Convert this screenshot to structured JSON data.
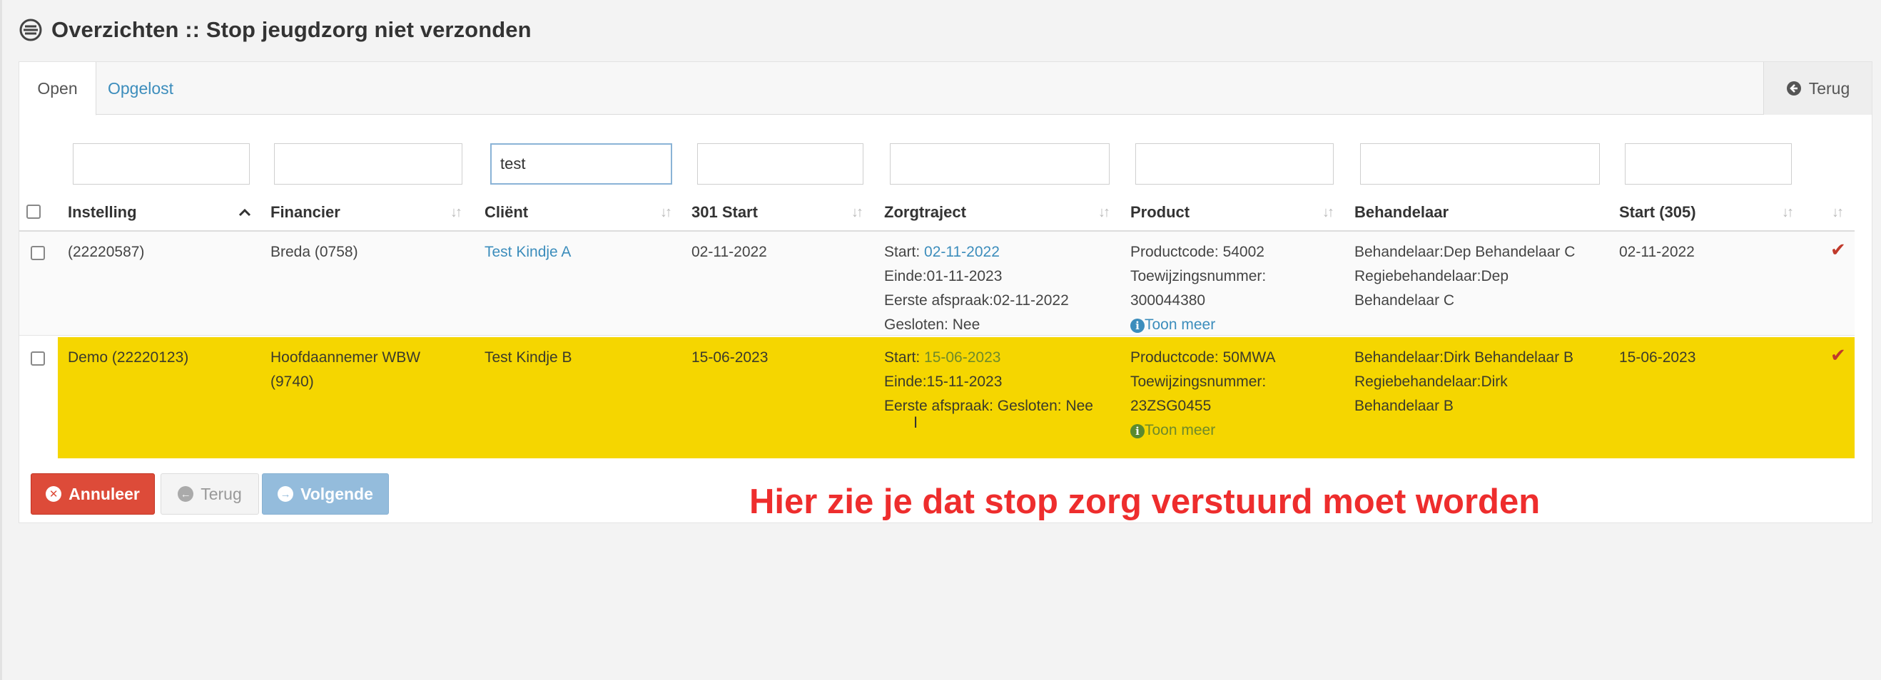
{
  "page": {
    "title": "Overzichten :: Stop jeugdzorg niet verzonden",
    "icon": "list-icon"
  },
  "tabs": [
    {
      "label": "Open",
      "active": true
    },
    {
      "label": "Opgelost",
      "active": false
    }
  ],
  "back_top": {
    "label": "Terug",
    "icon": "arrow-left-circle-icon"
  },
  "filters": {
    "instelling": "",
    "financier": "",
    "client": "test",
    "start301": "",
    "zorgtraject": "",
    "product": "",
    "behandelaar": "",
    "start305": ""
  },
  "columns": {
    "instelling": "Instelling",
    "financier": "Financier",
    "client": "Cliënt",
    "start301": "301 Start",
    "zorgtraject": "Zorgtraject",
    "product": "Product",
    "behandelaar": "Behandelaar",
    "start305": "Start (305)"
  },
  "rows": [
    {
      "highlighted": false,
      "instelling": "(22220587)",
      "financier": [
        "Breda (0758)"
      ],
      "client": "Test Kindje A",
      "start301": "02-11-2022",
      "zorgtraject": {
        "start_label": "Start: ",
        "start_date": "02-11-2022",
        "einde": "Einde:01-11-2023",
        "eerste": "Eerste afspraak:02-11-2022",
        "gesloten": "Gesloten: Nee"
      },
      "product": {
        "productcode": "Productcode: 54002",
        "toewijzing_label": "Toewijzingsnummer:",
        "toewijzing_nummer": "300044380",
        "toon_meer": "Toon meer"
      },
      "behandelaar": [
        "Behandelaar:Dep Behandelaar C",
        "Regiebehandelaar:Dep",
        "Behandelaar C"
      ],
      "start305": "02-11-2022"
    },
    {
      "highlighted": true,
      "instelling": "Demo (22220123)",
      "financier": [
        "Hoofdaannemer WBW",
        "(9740)"
      ],
      "client": "Test Kindje B",
      "start301": "15-06-2023",
      "zorgtraject": {
        "start_label": "Start: ",
        "start_date": "15-06-2023",
        "einde": "Einde:15-11-2023",
        "eerste": "Eerste afspraak: Gesloten: Nee"
      },
      "product": {
        "productcode": "Productcode: 50MWA",
        "toewijzing_label": "Toewijzingsnummer:",
        "toewijzing_nummer": "23ZSG0455",
        "toon_meer": "Toon meer"
      },
      "behandelaar": [
        "Behandelaar:Dirk Behandelaar B",
        "Regiebehandelaar:Dirk",
        "Behandelaar B"
      ],
      "start305": "15-06-2023"
    }
  ],
  "buttons": {
    "annuleer": "Annuleer",
    "terug": "Terug",
    "volgende": "Volgende"
  },
  "annotation": "Hier zie je dat stop zorg verstuurd moet worden",
  "colors": {
    "highlight": "#f5d600",
    "link": "#3c8dbc",
    "danger": "#dd4b39",
    "primary_disabled": "#94bcdc",
    "annotation": "#ee2d2d"
  }
}
